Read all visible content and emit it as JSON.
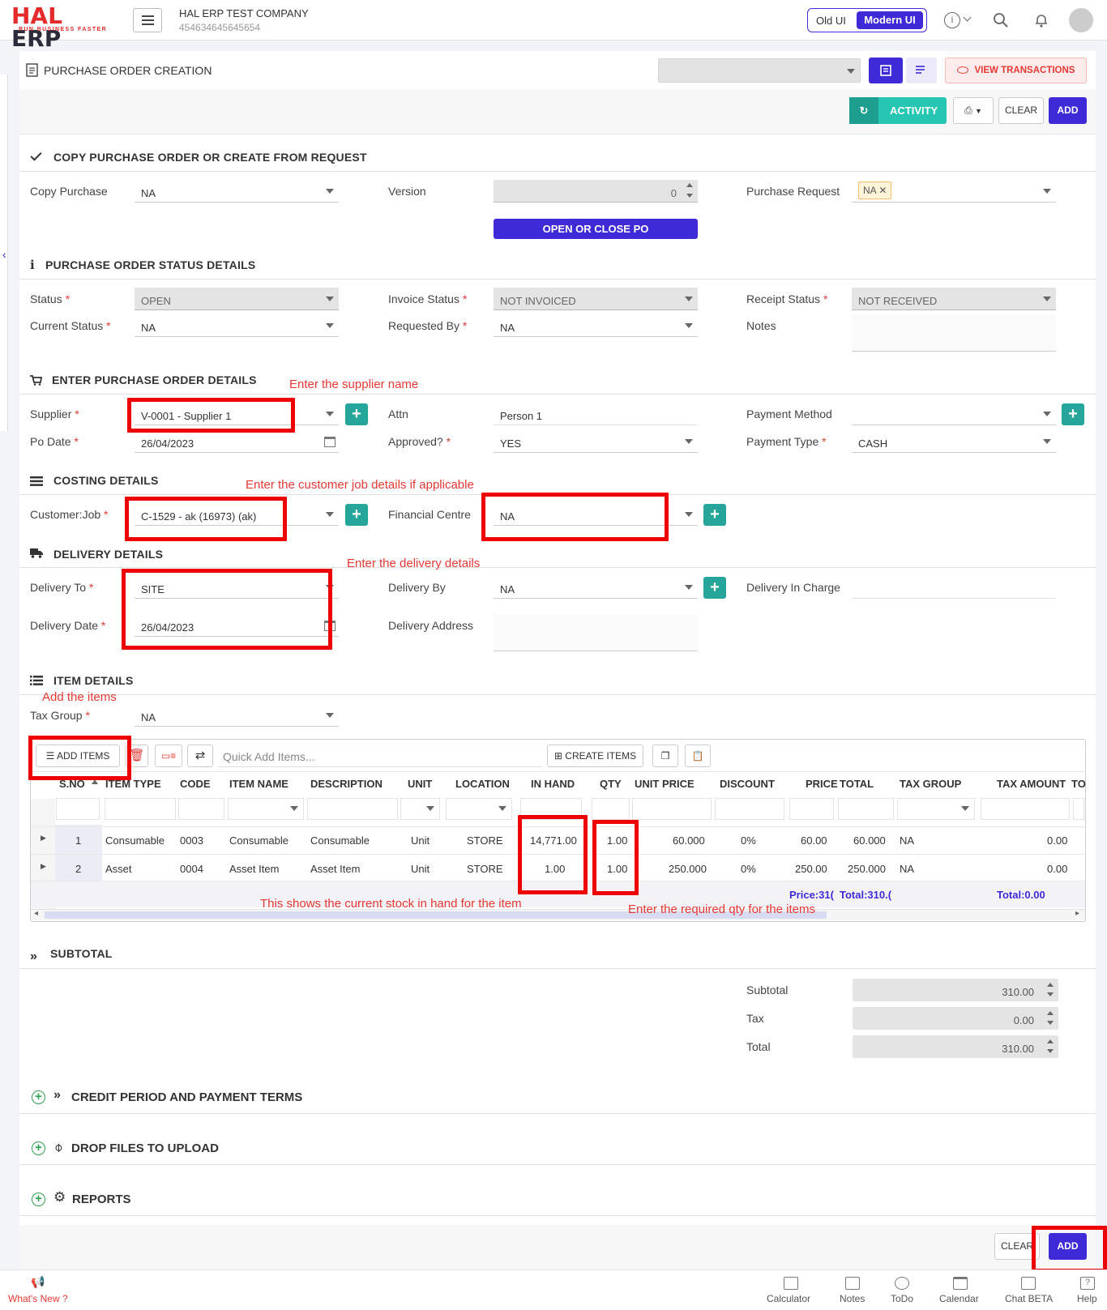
{
  "topbar": {
    "logo_main": "HAL ERP",
    "logo_tag": "RUN BUSINESS FASTER",
    "company_name": "HAL ERP TEST COMPANY",
    "company_id": "454634645645654",
    "old_ui": "Old UI",
    "modern_ui": "Modern UI"
  },
  "page": {
    "title": "PURCHASE ORDER CREATION",
    "view_transactions": "VIEW TRANSACTIONS",
    "activity": "ACTIVITY",
    "clear": "CLEAR",
    "add": "ADD"
  },
  "copy_section": {
    "title": "COPY PURCHASE ORDER OR CREATE FROM REQUEST",
    "copy_purchase_label": "Copy Purchase",
    "copy_purchase_value": "NA",
    "version_label": "Version",
    "version_value": "0",
    "open_close_po": "OPEN OR CLOSE PO",
    "purchase_request_label": "Purchase Request",
    "purchase_request_chip": "NA"
  },
  "status_section": {
    "title": "PURCHASE ORDER STATUS DETAILS",
    "status_label": "Status",
    "status_value": "OPEN",
    "invoice_status_label": "Invoice Status",
    "invoice_status_value": "NOT INVOICED",
    "receipt_status_label": "Receipt Status",
    "receipt_status_value": "NOT RECEIVED",
    "current_status_label": "Current Status",
    "current_status_value": "NA",
    "requested_by_label": "Requested By",
    "requested_by_value": "NA",
    "notes_label": "Notes"
  },
  "order_section": {
    "title": "ENTER PURCHASE ORDER DETAILS",
    "supplier_label": "Supplier",
    "supplier_value": "V-0001 - Supplier 1",
    "attn_label": "Attn",
    "attn_value": "Person 1",
    "payment_method_label": "Payment Method",
    "po_date_label": "Po Date",
    "po_date_value": "26/04/2023",
    "approved_label": "Approved?",
    "approved_value": "YES",
    "payment_type_label": "Payment Type",
    "payment_type_value": "CASH"
  },
  "costing_section": {
    "title": "COSTING DETAILS",
    "customer_job_label": "Customer:Job",
    "customer_job_value": "C-1529 - ak (16973) (ak)",
    "financial_centre_label": "Financial Centre",
    "financial_centre_value": "NA"
  },
  "delivery_section": {
    "title": "DELIVERY DETAILS",
    "delivery_to_label": "Delivery To",
    "delivery_to_value": "SITE",
    "delivery_by_label": "Delivery By",
    "delivery_by_value": "NA",
    "delivery_in_charge_label": "Delivery In Charge",
    "delivery_date_label": "Delivery Date",
    "delivery_date_value": "26/04/2023",
    "delivery_address_label": "Delivery Address"
  },
  "item_section": {
    "title": "ITEM DETAILS",
    "tax_group_label": "Tax Group",
    "tax_group_value": "NA",
    "add_items": "ADD ITEMS",
    "quick_add_placeholder": "Quick Add Items...",
    "create_items": "CREATE ITEMS",
    "columns": [
      "S.NO",
      "ITEM TYPE",
      "CODE",
      "ITEM NAME",
      "DESCRIPTION",
      "UNIT",
      "LOCATION",
      "IN HAND",
      "QTY",
      "UNIT PRICE",
      "DISCOUNT",
      "PRICE",
      "TOTAL",
      "TAX GROUP",
      "TAX AMOUNT",
      "TO"
    ],
    "rows": [
      [
        "1",
        "Consumable",
        "0003",
        "Consumable",
        "Consumable",
        "Unit",
        "STORE",
        "14,771.00",
        "1.00",
        "60.000",
        "0%",
        "60.00",
        "60.000",
        "NA",
        "0.00"
      ],
      [
        "2",
        "Asset",
        "0004",
        "Asset Item",
        "Asset Item",
        "Unit",
        "STORE",
        "1.00",
        "1.00",
        "250.000",
        "0%",
        "250.00",
        "250.000",
        "NA",
        "0.00"
      ]
    ],
    "footer_price": "Price:31(",
    "footer_total": "Total:310.(",
    "footer_tax_total": "Total:0.00"
  },
  "subtotal_section": {
    "title": "SUBTOTAL",
    "subtotal_label": "Subtotal",
    "subtotal_value": "310.00",
    "tax_label": "Tax",
    "tax_value": "0.00",
    "total_label": "Total",
    "total_value": "310.00"
  },
  "collapsed_sections": {
    "credit": "CREDIT PERIOD AND PAYMENT TERMS",
    "files": "DROP FILES TO UPLOAD",
    "reports": "REPORTS"
  },
  "annotations": {
    "supplier": "Enter the supplier name",
    "customer_job": "Enter the customer job details if applicable",
    "delivery": "Enter the delivery details",
    "add_items": "Add the items",
    "in_hand": "This shows the current stock in hand for the item",
    "qty": "Enter the required qty for the items"
  },
  "footer": {
    "clear": "CLEAR",
    "add": "ADD",
    "whats_new": "What's New ?",
    "calculator": "Calculator",
    "notes": "Notes",
    "todo": "ToDo",
    "calendar": "Calendar",
    "chat": "Chat BETA",
    "help": "Help"
  },
  "colors": {
    "brand_red": "#e32b2b",
    "primary": "#3f2ad8",
    "teal": "#26a69a",
    "annotation_red": "#e00000"
  }
}
